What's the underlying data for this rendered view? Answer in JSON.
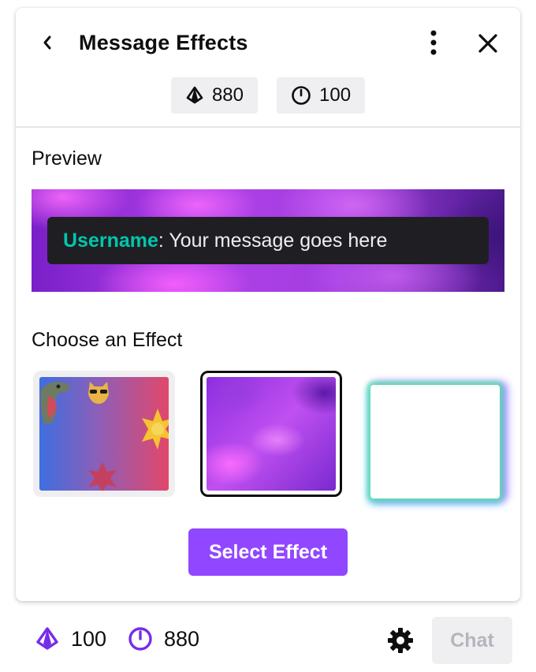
{
  "header": {
    "title": "Message Effects",
    "back_icon": "chevron-left-icon",
    "more_icon": "more-vertical-icon",
    "close_icon": "close-icon"
  },
  "balances": [
    {
      "icon": "bits-icon",
      "value": "880"
    },
    {
      "icon": "timer-icon",
      "value": "100"
    }
  ],
  "preview": {
    "label": "Preview",
    "username": "Username",
    "separator": ":",
    "message": " Your message goes here"
  },
  "effects": {
    "label": "Choose an Effect",
    "tiles": [
      {
        "name": "sticker-gradient",
        "selected": false
      },
      {
        "name": "purple-nebula",
        "selected": true
      },
      {
        "name": "rainbow-glow",
        "selected": false
      }
    ],
    "select_button": "Select Effect"
  },
  "footer": {
    "bits_value": "100",
    "points_value": "880",
    "settings_icon": "gear-icon",
    "chat_button": "Chat"
  },
  "colors": {
    "accent": "#9147ff",
    "username": "#00c7ac",
    "chat_bubble": "#1f1f23"
  }
}
